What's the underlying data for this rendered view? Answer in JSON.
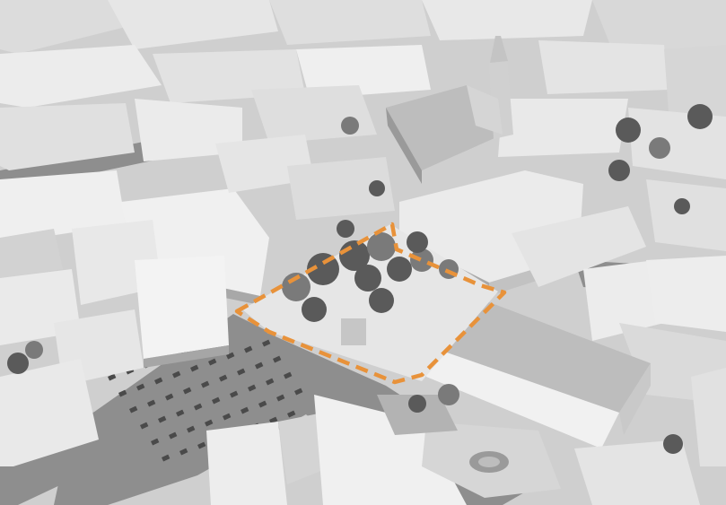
{
  "map": {
    "style": "grayscale-aerial-3d-city-model",
    "highlight": {
      "shape": "dashed-polygon",
      "color": "#E8923A"
    },
    "colors": {
      "background": "#cfcfcf",
      "street": "#8d8d8d",
      "roof_light": "#f2f2f2",
      "roof_mid": "#dedede",
      "roof_dark": "#b8b8b8",
      "wall_shadow": "#9c9c9c",
      "tree": "#5a5a5a",
      "tree_light": "#7a7a7a",
      "plaza": "#e6e6e6"
    }
  }
}
